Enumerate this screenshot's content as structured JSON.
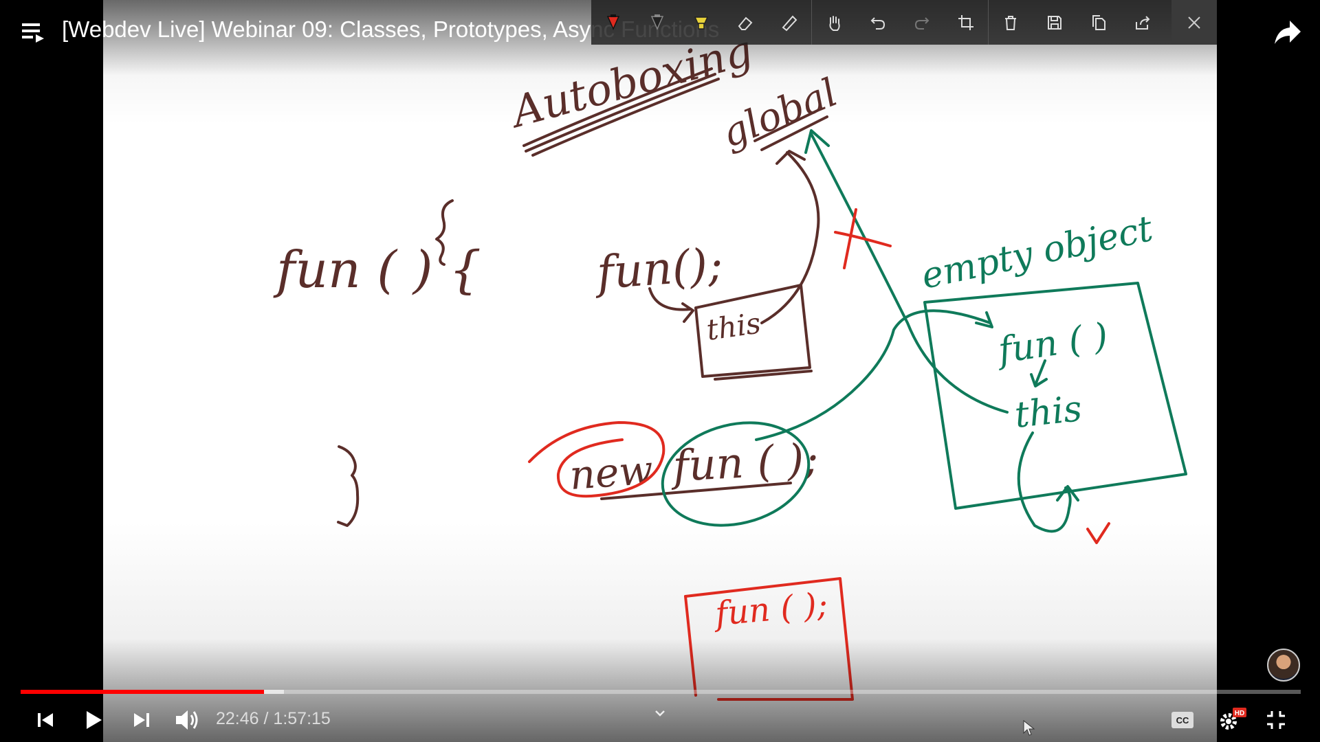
{
  "video": {
    "title": "[Webdev Live] Webinar 09: Classes, Prototypes, Async Functions",
    "time_current": "22:46",
    "time_separator": "/",
    "time_total": "1:57:15",
    "progress_fraction": 0.1903,
    "buffer_fraction": 0.2055,
    "quality_badge": "HD"
  },
  "whiteboard": {
    "texts": [
      "Autoboxing",
      "global",
      "fun ( ) {",
      "}",
      "fun();",
      "this",
      "empty object",
      "fun ( )",
      "this",
      "new",
      "fun ( );",
      "fun ( );"
    ]
  },
  "colors": {
    "ink_brown": "#5a2e2a",
    "ink_green": "#0f7a5a",
    "ink_red": "#e02a1f",
    "progress_red": "#ff0000"
  },
  "toolbar": {
    "tools": [
      "red-pen-icon",
      "black-pen-icon",
      "highlighter-icon",
      "eraser-icon",
      "ruler-icon",
      "hand-icon",
      "undo-icon",
      "redo-icon",
      "crop-icon",
      "delete-icon",
      "save-icon",
      "copy-icon",
      "export-icon",
      "close-icon"
    ]
  }
}
